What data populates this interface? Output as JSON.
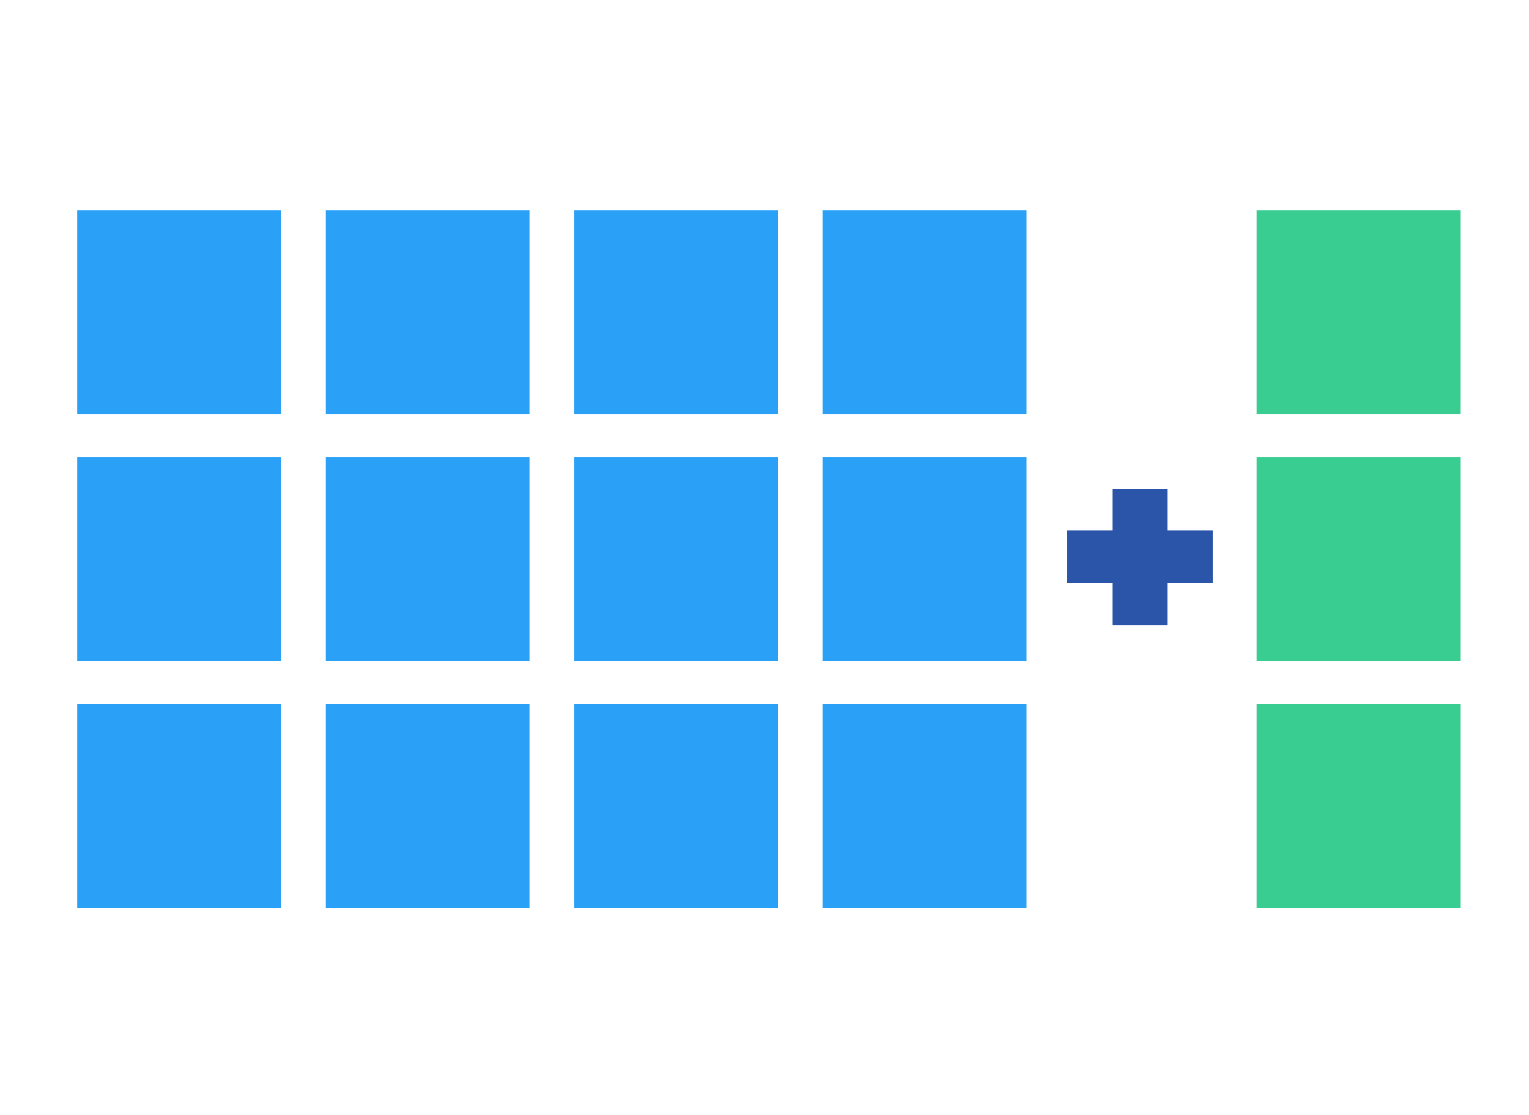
{
  "diagram": {
    "left_group": {
      "rows": 3,
      "columns": 4,
      "color": "#2aa0f6"
    },
    "operator": {
      "icon": "plus-icon",
      "color": "#2b55a9"
    },
    "right_group": {
      "rows": 3,
      "columns": 1,
      "color": "#3acd91"
    }
  }
}
